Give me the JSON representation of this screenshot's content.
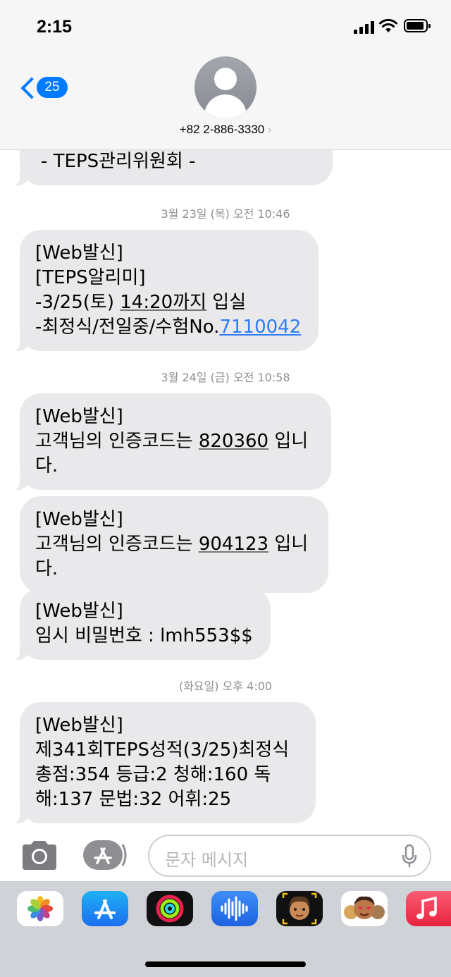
{
  "status_bar": {
    "time": "2:15"
  },
  "header": {
    "back_badge": "25",
    "contact": "+82 2-886-3330",
    "contact_chevron": "›"
  },
  "messages": [
    {
      "lines": [
        "- TEPS관리위원회 -"
      ]
    },
    {
      "timestamp": "3월 23일 (목) 오전 10:46"
    },
    {
      "line1": "[Web발신]",
      "line2": "[TEPS알리미]",
      "line3_prefix": "-3/25(토) ",
      "line3_time": "14:20까지",
      "line3_suffix": " 입실",
      "line4_prefix": "-최정식/전일중/수험No.",
      "line4_link": "7110042"
    },
    {
      "timestamp": "3월 24일 (금) 오전 10:58"
    },
    {
      "line1": "[Web발신]",
      "line2_prefix": "고객님의 인증코드는 ",
      "code": "820360",
      "line2_suffix": " 입니",
      "line3": "다."
    },
    {
      "line1": "[Web발신]",
      "line2_prefix": "고객님의 인증코드는 ",
      "code": "904123",
      "line2_suffix": " 입니",
      "line3": "다."
    },
    {
      "line1": "[Web발신]",
      "line2": "임시 비밀번호 : lmh553$$"
    },
    {
      "timestamp": "(화요일) 오후 4:00"
    },
    {
      "line1": "[Web발신]",
      "line2": "제341회TEPS성적(3/25)최정식",
      "line3": "총점:354 등급:2 청해:160 독",
      "line4": "해:137 문법:32 어휘:25"
    }
  ],
  "composer": {
    "placeholder": "문자 메시지"
  },
  "app_tray": [
    "photos-icon",
    "app-store-icon",
    "activity-icon",
    "audio-message-icon",
    "memoji-icon",
    "animoji-icon",
    "music-icon"
  ],
  "colors": {
    "accent": "#007aff",
    "bubble": "#e9e9eb",
    "link": "#2f7cf6",
    "tray": "#cfd2d7"
  }
}
